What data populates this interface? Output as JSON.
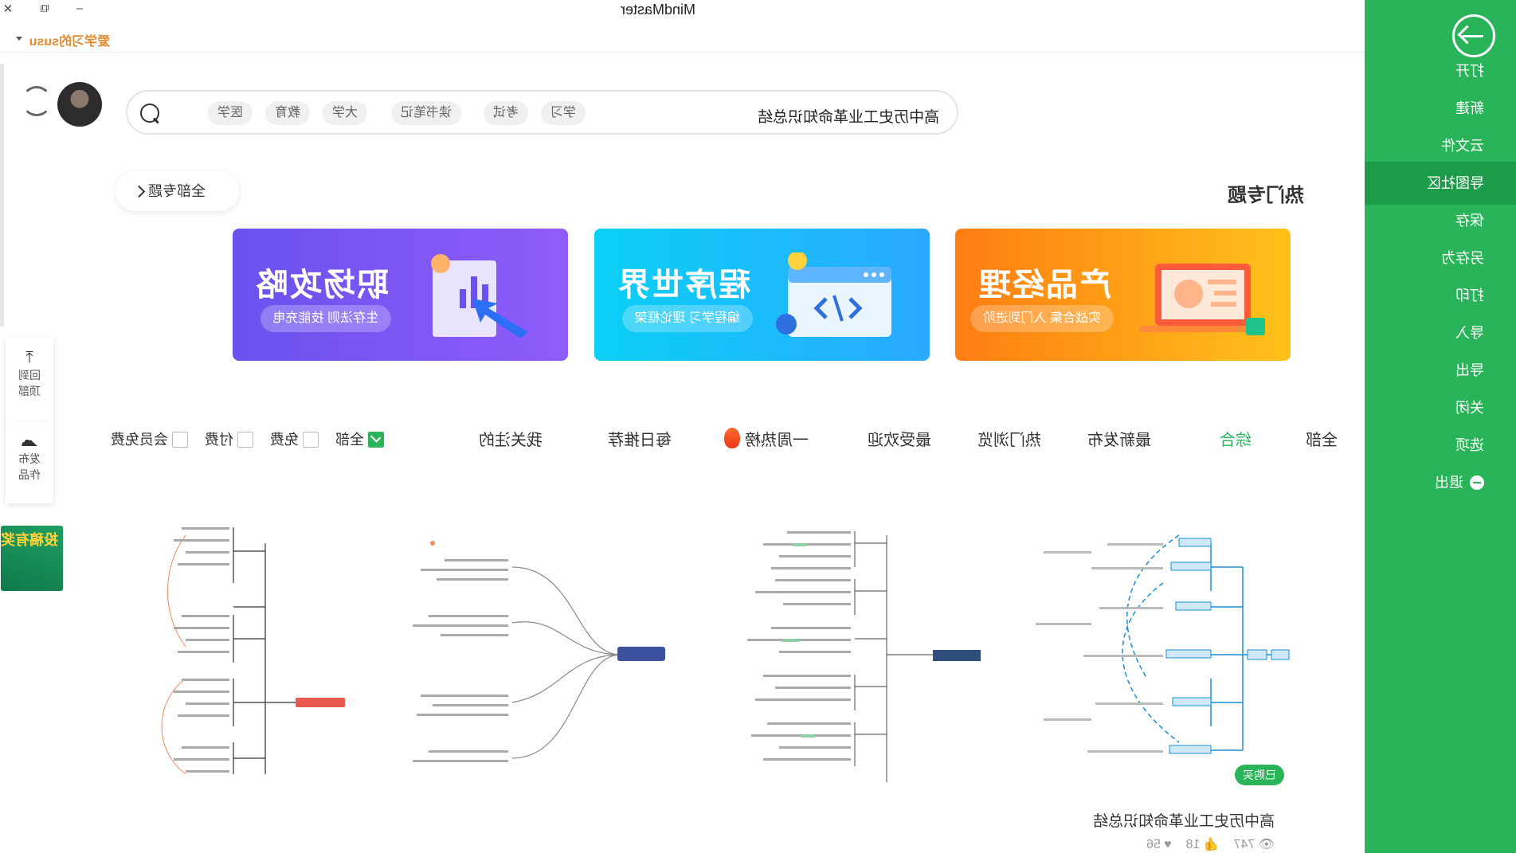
{
  "window": {
    "title": "MindMaster",
    "close_glyph": "✕",
    "restore_glyph": "⧉",
    "minimize_glyph": "–"
  },
  "user": {
    "name": "爱学习的susu"
  },
  "side_menu": {
    "items": [
      "打开",
      "新建",
      "云文件",
      "导图社区",
      "保存",
      "另存为",
      "打印",
      "导入",
      "导出",
      "关闭",
      "选项",
      "退出"
    ],
    "active": "导图社区"
  },
  "search": {
    "query": "高中历史工业革命知识总结",
    "tags": [
      "学习",
      "考试",
      "读书笔记",
      "大学",
      "教育",
      "医学"
    ]
  },
  "section": {
    "title": "热门专题",
    "all_label": "全部专题"
  },
  "banners": [
    {
      "title": "产品经理",
      "subtitle": "实战合集 入门到进阶"
    },
    {
      "title": "程序世界",
      "subtitle": "编程学习 理论框架"
    },
    {
      "title": "职场攻略",
      "subtitle": "生存法则 技能充电"
    }
  ],
  "tabs": [
    "全部",
    "综合",
    "最新发布",
    "热门浏览",
    "最受欢迎",
    "一周热榜",
    "每日推荐",
    "我关注的"
  ],
  "active_tab": "综合",
  "filters": [
    {
      "label": "全部",
      "checked": true
    },
    {
      "label": "免费",
      "checked": false
    },
    {
      "label": "付费",
      "checked": false
    },
    {
      "label": "会员免费",
      "checked": false
    }
  ],
  "cards": [
    {
      "title": "高中历史工业革命知识总结",
      "views": "747",
      "likes": "18",
      "favs": "56",
      "badge": "已购买"
    }
  ],
  "floatbar": {
    "top_label_1": "回到",
    "top_label_2": "顶部",
    "publish_label_1": "发布",
    "publish_label_2": "作品"
  },
  "promo": {
    "text": "投稿有奖"
  },
  "colors": {
    "accent": "#29b45a",
    "username": "#e7892f"
  }
}
